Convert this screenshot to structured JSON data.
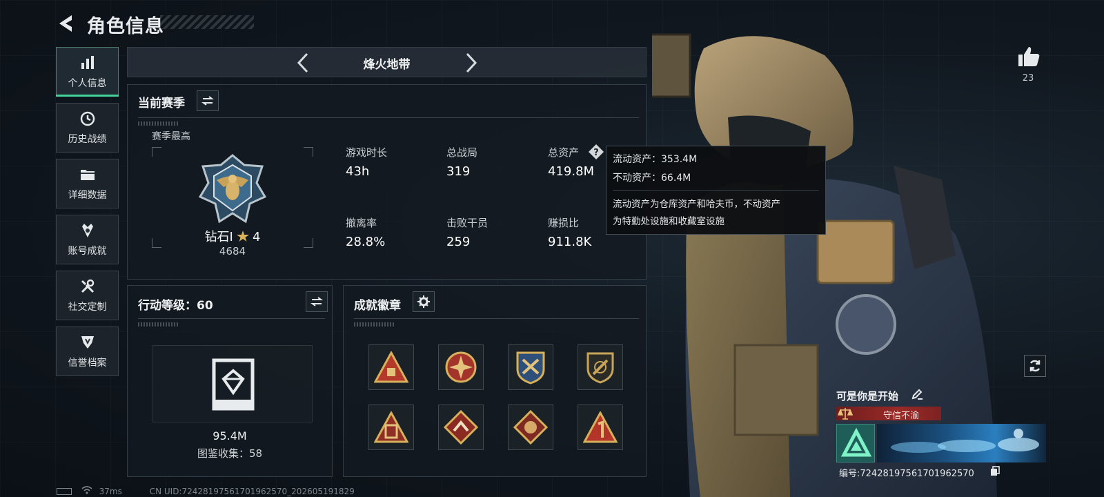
{
  "header": {
    "title": "角色信息"
  },
  "nav": {
    "items": [
      {
        "label": "个人信息",
        "icon": "bar-chart-icon",
        "active": true
      },
      {
        "label": "历史战绩",
        "icon": "clock-icon",
        "active": false
      },
      {
        "label": "详细数据",
        "icon": "folder-icon",
        "active": false
      },
      {
        "label": "账号成就",
        "icon": "medal-icon",
        "active": false
      },
      {
        "label": "社交定制",
        "icon": "tools-icon",
        "active": false
      },
      {
        "label": "信誉档案",
        "icon": "shield-icon",
        "active": false
      }
    ]
  },
  "mode_bar": {
    "title": "烽火地带"
  },
  "season": {
    "title": "当前赛季",
    "best_label": "赛季最高",
    "rank_name": "钻石I",
    "rank_stars": "4",
    "rank_score": "4684",
    "stats": [
      {
        "label": "游戏时长",
        "value": "43h"
      },
      {
        "label": "总战局",
        "value": "319"
      },
      {
        "label": "总资产",
        "value": "419.8M"
      },
      {
        "label": "撤离率",
        "value": "28.8%"
      },
      {
        "label": "击败干员",
        "value": "259"
      },
      {
        "label": "赚损比",
        "value": "911.8K"
      }
    ]
  },
  "tooltip": {
    "liquid": "流动资产：353.4M",
    "fixed": "不动资产：66.4M",
    "desc_line1": "流动资产为仓库资产和哈夫币，不动资产",
    "desc_line2": "为特勤处设施和收藏室设施"
  },
  "action_level": {
    "title": "行动等级：60",
    "value": "95.4M",
    "collection": "图鉴收集：58"
  },
  "achievements": {
    "title": "成就徽章",
    "badges": [
      "badge-1",
      "badge-2",
      "badge-3",
      "badge-4",
      "badge-5",
      "badge-6",
      "badge-7",
      "badge-8"
    ]
  },
  "profile": {
    "likes": "23",
    "player_name": "可是你是开始",
    "reputation": "守信不渝",
    "uid": "编号:7242819756170196​2570"
  },
  "status_bar": {
    "ping": "37ms",
    "uid": "CN UID:7242819756170196​2570_202605191829"
  },
  "colors": {
    "accent": "#44d39a",
    "reputation_red": "#9a2a27",
    "background": "#111820"
  }
}
